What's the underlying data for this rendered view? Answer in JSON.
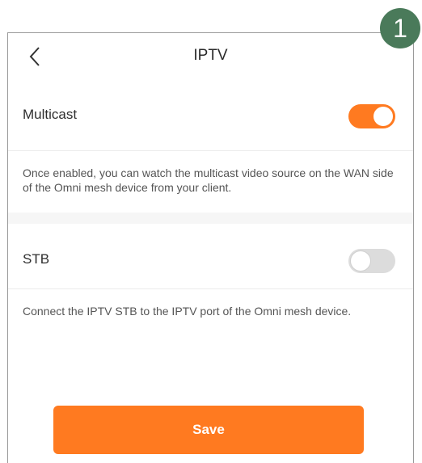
{
  "step_badge": "1",
  "header": {
    "title": "IPTV",
    "back_icon": "chevron-left-icon"
  },
  "multicast": {
    "label": "Multicast",
    "enabled": true,
    "description": "Once enabled, you can watch the multicast video source on the WAN side of the Omni mesh device from your client."
  },
  "stb": {
    "label": "STB",
    "enabled": false,
    "description": "Connect the IPTV STB to the IPTV port of the Omni mesh device."
  },
  "save_label": "Save",
  "colors": {
    "accent": "#ff7a20",
    "toggle_off": "#dcdcdc",
    "badge": "#4a7a5a"
  }
}
